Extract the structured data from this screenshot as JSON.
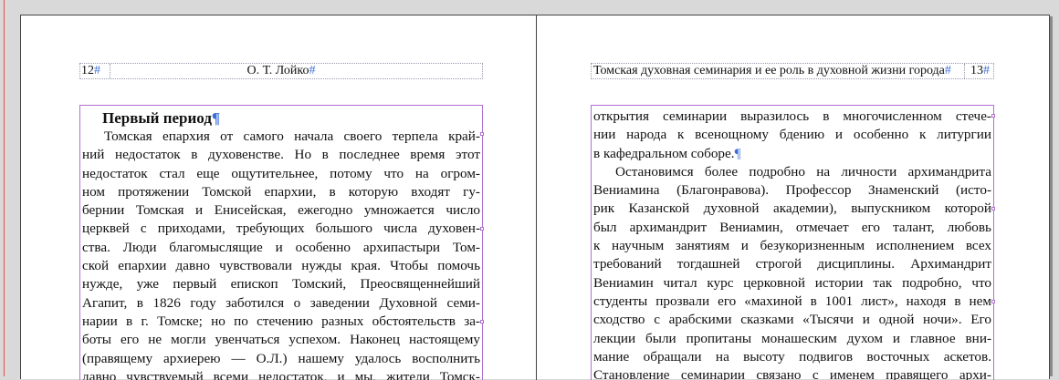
{
  "left_page": {
    "folio": "12",
    "running_head": "О. Т. Лойко",
    "heading": "Первый период",
    "lines": [
      "Томская епархия от самого начала своего терпела край-",
      "ний недостаток в духовенстве. Но в последнее время этот",
      "недостаток стал еще ощутительнее, потому что на огром-",
      "ном протяжении Томской епархии, в которую входят гу-",
      "бернии Томская и Енисейская, ежегодно умножается число",
      "церквей с приходами, требующих большого числа духовен-",
      "ства. Люди благомыслящие и особенно архипастыри Том-",
      "ской епархии давно чувствовали нужды края. Чтобы помочь",
      "нужде, уже первый епископ Томский, Преосвященнейший",
      "Агапит, в 1826 году заботился о заведении Духовной семи-",
      "нарии в г. Томске; но по стечению разных обстоятельств за-",
      "боты его не могли увенчаться успехом. Наконец настоящему",
      "(правящему архиерею — О.Л.) нашему удалось восполнить",
      "давно чувствуемый всеми недостаток, и мы, жители Томск-"
    ]
  },
  "right_page": {
    "folio": "13",
    "running_head": "Томская духовная семинария и ее роль в духовной жизни города",
    "lines": [
      "открытия семинарии выразилось в многочисленном стече-",
      "нии народа к всенощному бдению и особенно к литургии",
      "в кафедральном соборе.",
      "Остановимся более подробно на личности архимандрита",
      "Вениамина (Благонравова). Профессор Знаменский (исто-",
      "рик Казанской духовной академии), выпускником которой",
      "был архимандрит Вениамин, отмечает его талант, любовь",
      "к научным занятиям и безукоризненным исполнением всех",
      "требований тогдашней строгой дисциплины. Архимандрит",
      "Вениамин читал курс церковной истории так подробно, что",
      "студенты прозвали его «махиной в 1001 лист», находя в нем",
      "сходство с арабскими сказками «Тысячи и одной ночи». Его",
      "лекции были пропитаны монашеским духом и главное вни-",
      "мание обращали на высоту подвигов восточных аскетов.",
      "Становление семинарии связано с именем правящего архи-"
    ]
  },
  "marks": {
    "pilcrow": "¶",
    "hash": "#"
  },
  "colors": {
    "frame": "#b070d0",
    "hidden_char": "#3b6fd8",
    "pasteboard": "#d9d9d9"
  }
}
